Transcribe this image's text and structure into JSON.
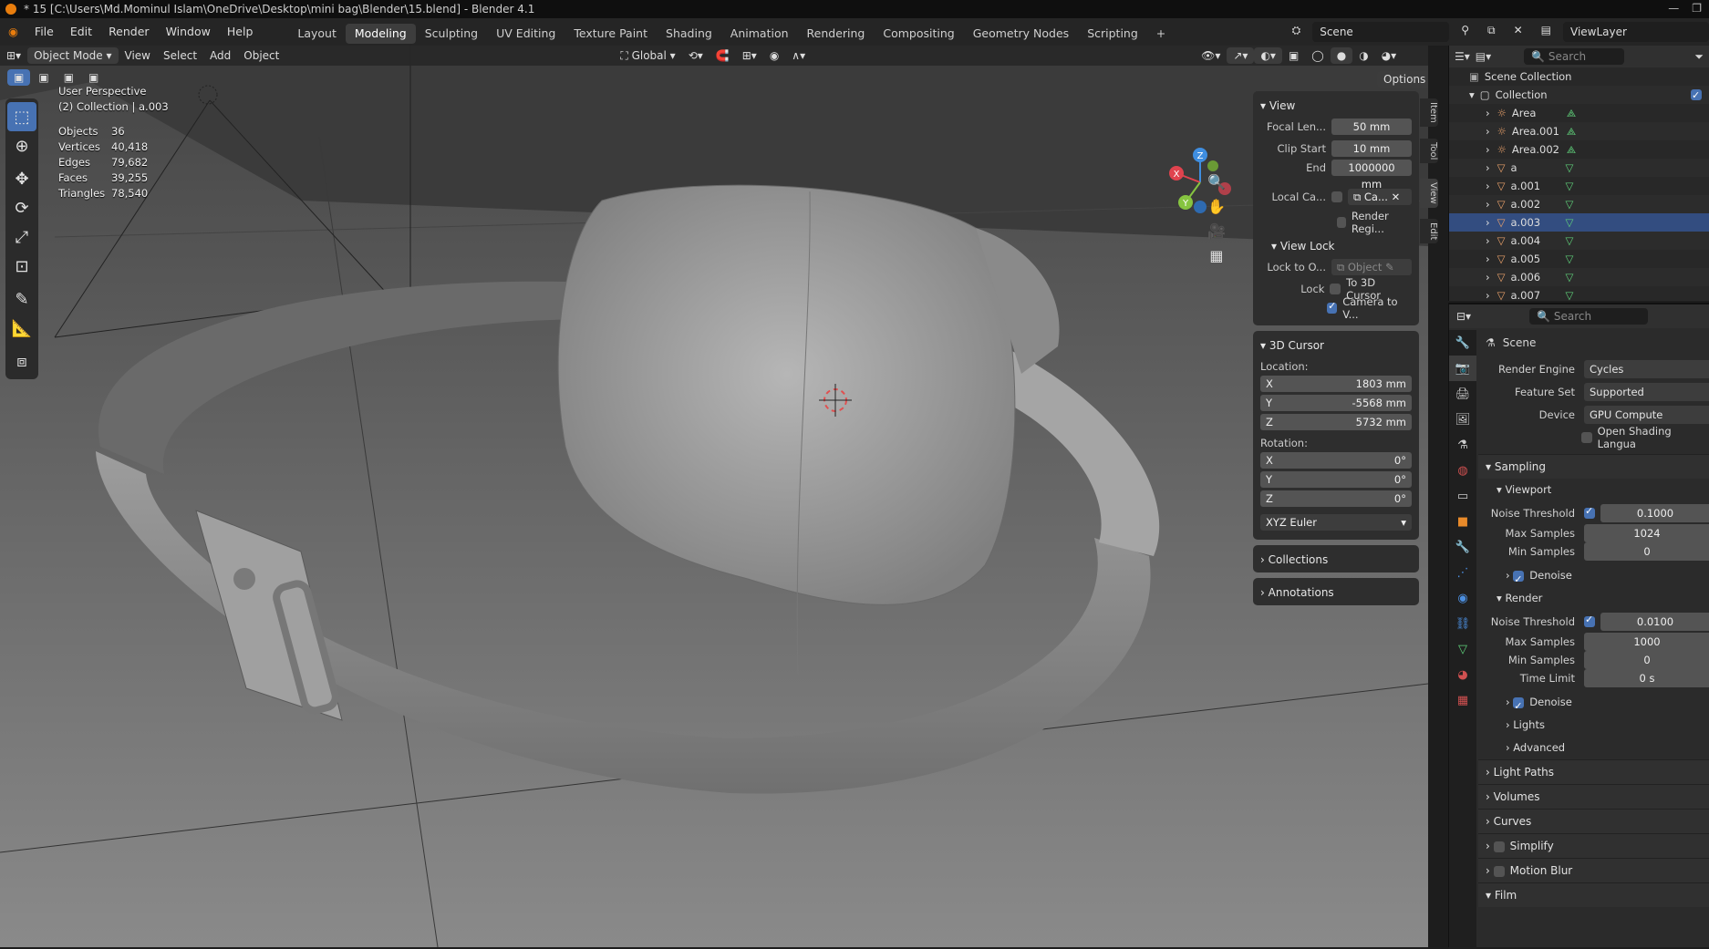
{
  "title_bar": {
    "text": "* 15 [C:\\Users\\Md.Mominul Islam\\OneDrive\\Desktop\\mini bag\\Blender\\15.blend] - Blender 4.1"
  },
  "menu": [
    "File",
    "Edit",
    "Render",
    "Window",
    "Help"
  ],
  "workspaces": [
    "Layout",
    "Modeling",
    "Sculpting",
    "UV Editing",
    "Texture Paint",
    "Shading",
    "Animation",
    "Rendering",
    "Compositing",
    "Geometry Nodes",
    "Scripting"
  ],
  "active_workspace": "Modeling",
  "scene_name": "Scene",
  "view_layer": "ViewLayer",
  "viewport_header": {
    "mode": "Object Mode",
    "menus": [
      "View",
      "Select",
      "Add",
      "Object"
    ],
    "orientation": "Global",
    "options": "Options"
  },
  "overlay": {
    "view_name": "User Perspective",
    "collection": "(2) Collection | a.003",
    "stats": [
      {
        "label": "Objects",
        "value": "36"
      },
      {
        "label": "Vertices",
        "value": "40,418"
      },
      {
        "label": "Edges",
        "value": "79,682"
      },
      {
        "label": "Faces",
        "value": "39,255"
      },
      {
        "label": "Triangles",
        "value": "78,540"
      }
    ]
  },
  "gizmo": {
    "x": "X",
    "y": "Y",
    "z": "Z"
  },
  "npanel": {
    "tabs": [
      "Item",
      "Tool",
      "View",
      "Edit"
    ],
    "view": {
      "title": "View",
      "focal_label": "Focal Len...",
      "focal_value": "50 mm",
      "clip_start_label": "Clip Start",
      "clip_start_value": "10 mm",
      "end_label": "End",
      "end_value": "1000000 mm",
      "local_camera_label": "Local Ca...",
      "local_camera_value": "Ca...",
      "render_region": "Render Regi..."
    },
    "view_lock": {
      "title": "View Lock",
      "lock_to_label": "Lock to O...",
      "lock_to_value": "Object",
      "lock_label": "Lock",
      "to_cursor": "To 3D Cursor",
      "camera_to_view": "Camera to V..."
    },
    "cursor": {
      "title": "3D Cursor",
      "location_label": "Location:",
      "loc_x": "1803 mm",
      "loc_y": "-5568 mm",
      "loc_z": "5732 mm",
      "rotation_label": "Rotation:",
      "rot_x": "0°",
      "rot_y": "0°",
      "rot_z": "0°",
      "mode": "XYZ Euler"
    },
    "collections": "Collections",
    "annotations": "Annotations"
  },
  "outliner": {
    "search_placeholder": "Search",
    "scene_collection": "Scene Collection",
    "collection": "Collection",
    "items": [
      {
        "name": "Area",
        "type": "light"
      },
      {
        "name": "Area.001",
        "type": "light"
      },
      {
        "name": "Area.002",
        "type": "light"
      },
      {
        "name": "a",
        "type": "mesh"
      },
      {
        "name": "a.001",
        "type": "mesh"
      },
      {
        "name": "a.002",
        "type": "mesh"
      },
      {
        "name": "a.003",
        "type": "mesh"
      },
      {
        "name": "a.004",
        "type": "mesh"
      },
      {
        "name": "a.005",
        "type": "mesh"
      },
      {
        "name": "a.006",
        "type": "mesh"
      },
      {
        "name": "a.007",
        "type": "mesh"
      }
    ]
  },
  "properties": {
    "search_placeholder": "Search",
    "context": "Scene",
    "render_engine_label": "Render Engine",
    "render_engine": "Cycles",
    "feature_set_label": "Feature Set",
    "feature_set": "Supported",
    "device_label": "Device",
    "device": "GPU Compute",
    "osl": "Open Shading Langua",
    "sampling": "Sampling",
    "viewport": "Viewport",
    "vp_noise_label": "Noise Threshold",
    "vp_noise": "0.1000",
    "vp_max_label": "Max Samples",
    "vp_max": "1024",
    "vp_min_label": "Min Samples",
    "vp_min": "0",
    "denoise": "Denoise",
    "render": "Render",
    "r_noise_label": "Noise Threshold",
    "r_noise": "0.0100",
    "r_max_label": "Max Samples",
    "r_max": "1000",
    "r_min_label": "Min Samples",
    "r_min": "0",
    "time_limit_label": "Time Limit",
    "time_limit": "0 s",
    "denoise2": "Denoise",
    "lights": "Lights",
    "advanced": "Advanced",
    "sections": [
      "Light Paths",
      "Volumes",
      "Curves",
      "Simplify",
      "Motion Blur",
      "Film"
    ]
  },
  "colors": {
    "accent": "#4772b3",
    "x_axis": "#e0434e",
    "y_axis": "#86c440",
    "z_axis": "#3f8ee0",
    "light_icon": "#e8a06a",
    "mesh_icon": "#e8a06a",
    "data_icon": "#5fd07a"
  }
}
